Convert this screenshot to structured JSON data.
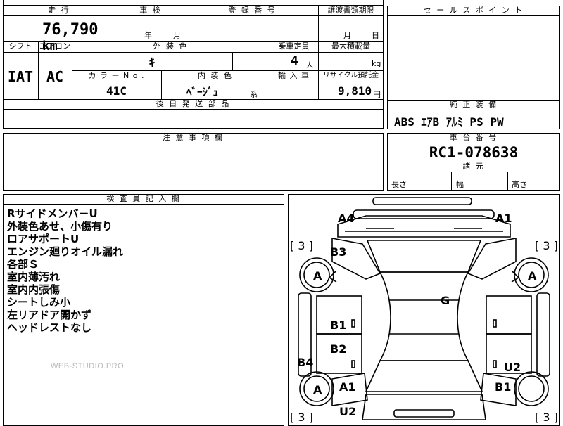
{
  "headers": {
    "mileage": "走 行",
    "inspection": "車 検",
    "registration": "登 録 番 号",
    "transfer": "譲渡書類期限",
    "sales_point": "セ ー ル ス ポ イ ン ト",
    "shift": "シフト",
    "aircon": "エアコン",
    "exterior_color": "外 装 色",
    "capacity": "乗車定員",
    "max_load": "最大積載量",
    "color_no": "カ ラ ー N o .",
    "interior_color": "内 装 色",
    "import": "輸 入 車",
    "recycle": "リサイクル預託金",
    "later_parts": "後 日 発 送 部 品",
    "genuine_equipment": "純 正 装 備",
    "caution": "注 意 事 項 欄",
    "chassis_no": "車 台 番 号",
    "specs": "諸 元",
    "inspector": "検 査 員 記 入 欄"
  },
  "values": {
    "mileage": "76,790",
    "mileage_unit": "km",
    "inspection_year": "年",
    "inspection_month": "月",
    "transfer_month": "月",
    "transfer_day": "日",
    "shift": "IAT",
    "aircon": "AC",
    "exterior_color": "ｷ",
    "capacity": "4",
    "capacity_unit": "人",
    "max_load_unit": "kg",
    "color_no": "41C",
    "interior_color": "ﾍﾞｰｼﾞｭ",
    "interior_suffix": "系",
    "recycle": "9,810",
    "recycle_unit": "円",
    "equipment": "ABS ｴｱB ｱﾙﾐ PS PW",
    "chassis_no": "RC1-078638",
    "spec_length": "長さ",
    "spec_width": "幅",
    "spec_height": "高さ"
  },
  "inspector_notes": [
    "Rサイドメンバ－U",
    "外装色あせ、小傷有り",
    "ロアサポートU",
    "エンジン廻りオイル漏れ",
    "各部Ｓ",
    "室内薄汚れ",
    "室内内張傷",
    "シートしみ小",
    "左リアドア開かず",
    "ヘッドレストなし"
  ],
  "watermark": "WEB-STUDIO.PRO",
  "diagram": {
    "marks": {
      "a4": "A4",
      "a1_top": "A1",
      "b3": "B3",
      "g": "G",
      "b1_left": "B1",
      "b2": "B2",
      "b4": "B4",
      "u2_right": "U2",
      "a1_left": "A1",
      "b1_right": "B1",
      "u2_bottom": "U2",
      "tire_a": "A",
      "bracket_3": "[ 3 ]"
    }
  }
}
